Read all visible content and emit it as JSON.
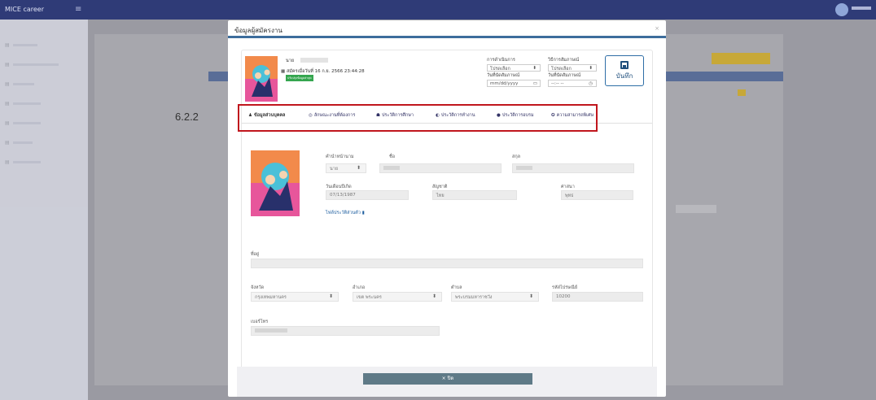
{
  "app": {
    "brand": "MICE career",
    "sidebar_items": [
      {
        "label": "ระบบจัดการ"
      },
      {
        "label": "ผู้สมัคร"
      },
      {
        "label": "รายงาน"
      },
      {
        "label": "ตั้งค่า"
      },
      {
        "label": "ข่าวสาร"
      },
      {
        "label": "คู่มือ"
      },
      {
        "label": "ผู้ใช้งาน"
      }
    ]
  },
  "modal": {
    "title": "ข้อมูลผู้สมัครงาน",
    "close": "×",
    "applicant": {
      "prefix": "นาย",
      "applied_date": "สมัครเมื่อวันที่ 16 ก.ย. 2566 23:44:28",
      "badge": "ปรับปรุงข้อมูลล่าสุด"
    },
    "process": {
      "label": "การดำเนินการ",
      "value": "โปรดเลือก"
    },
    "interview_method": {
      "label": "วิธีการสัมภาษณ์",
      "value": "โปรดเลือก"
    },
    "interview_date": {
      "label": "วันที่นัดสัมภาษณ์",
      "value": "mm/dd/yyyy"
    },
    "interview_time": {
      "label": "วันที่นัดสัมภาษณ์",
      "value": "--:-- --"
    },
    "save_label": "บันทึก",
    "tabs": [
      {
        "label": "ข้อมูลส่วนบุคคล",
        "icon": "user-icon"
      },
      {
        "label": "ลักษณะงานที่ต้องการ",
        "icon": "target-icon"
      },
      {
        "label": "ประวัติการศึกษา",
        "icon": "graduation-cap-icon"
      },
      {
        "label": "ประวัติการทำงาน",
        "icon": "briefcase-icon"
      },
      {
        "label": "ประวัติการอบรม",
        "icon": "dot-icon"
      },
      {
        "label": "ความสามารถพิเศษ",
        "icon": "star-icon"
      }
    ],
    "step_label": "6.2.2",
    "form": {
      "title_prefix_label": "คำนำหน้านาม",
      "title_prefix_value": "นาย",
      "first_name_label": "ชื่อ",
      "last_name_label": "สกุล",
      "birthdate_label": "วันเดือนปีเกิด",
      "birthdate_value": "07/13/1987",
      "nationality_label": "สัญชาติ",
      "nationality_value": "ไทย",
      "religion_label": "ศาสนา",
      "religion_value": "พุทธ",
      "resume_link": "ไฟล์ประวัติส่วนตัว",
      "address_label": "ที่อยู่",
      "province_label": "จังหวัด",
      "province_value": "กรุงเทพมหานคร",
      "district_label": "อำเภอ",
      "district_value": "เขต พระนคร",
      "subdistrict_label": "ตำบล",
      "subdistrict_value": "พระบรมมหาราชวัง",
      "postal_label": "รหัสไปรษณีย์",
      "postal_value": "10200",
      "phone_label": "เบอร์โทร"
    },
    "footer_close": "× ปิด"
  },
  "colors": {
    "topbar": "#2f3b77",
    "modal_accent": "#3d6d9c",
    "highlight": "#c0161d",
    "save": "#1f4f7d"
  }
}
